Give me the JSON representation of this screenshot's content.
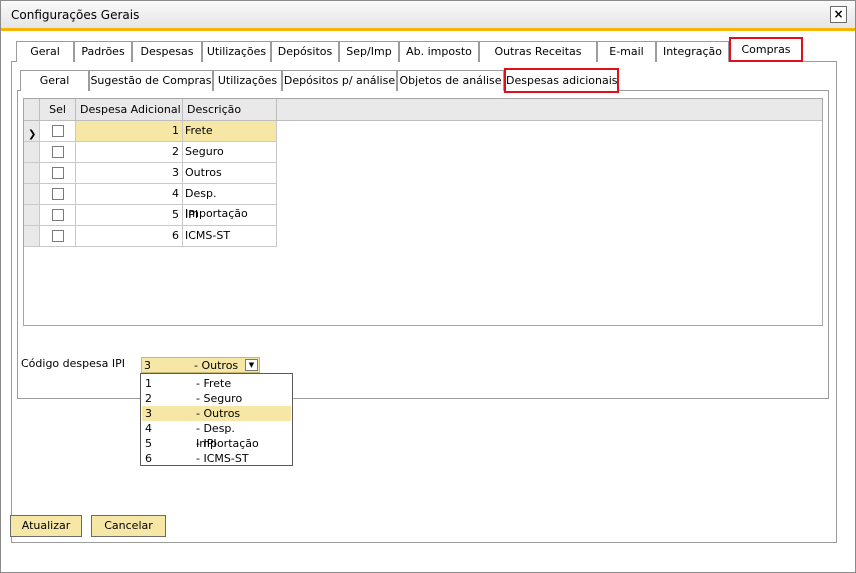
{
  "window": {
    "title": "Configurações Gerais",
    "close": "×"
  },
  "main_tabs": [
    "Geral",
    "Padrões",
    "Despesas",
    "Utilizações",
    "Depósitos",
    "Sep/Imp",
    "Ab. imposto",
    "Outras Receitas",
    "E-mail",
    "Integração",
    "Compras"
  ],
  "sub_tabs": [
    "Geral",
    "Sugestão de Compras",
    "Utilizações",
    "Depósitos p/ análise",
    "Objetos de análise",
    "Despesas adicionais"
  ],
  "grid": {
    "columns": [
      "Sel",
      "Despesa Adicional",
      "Descrição"
    ],
    "rows": [
      {
        "code": "1",
        "desc": "Frete"
      },
      {
        "code": "2",
        "desc": "Seguro"
      },
      {
        "code": "3",
        "desc": "Outros"
      },
      {
        "code": "4",
        "desc": "Desp. Importação"
      },
      {
        "code": "5",
        "desc": "IPI"
      },
      {
        "code": "6",
        "desc": "ICMS-ST"
      }
    ]
  },
  "ipi": {
    "label": "Código despesa IPI",
    "value": "3",
    "value_desc": "- Outros",
    "options": [
      {
        "code": "1",
        "desc": "- Frete"
      },
      {
        "code": "2",
        "desc": "- Seguro"
      },
      {
        "code": "3",
        "desc": "- Outros"
      },
      {
        "code": "4",
        "desc": "- Desp. Importação"
      },
      {
        "code": "5",
        "desc": "- IPI"
      },
      {
        "code": "6",
        "desc": "- ICMS-ST"
      }
    ]
  },
  "buttons": {
    "update": "Atualizar",
    "cancel": "Cancelar"
  },
  "colors": {
    "accent": "#f5b400",
    "highlight": "#e0101a",
    "selection": "#f7e7a6"
  }
}
